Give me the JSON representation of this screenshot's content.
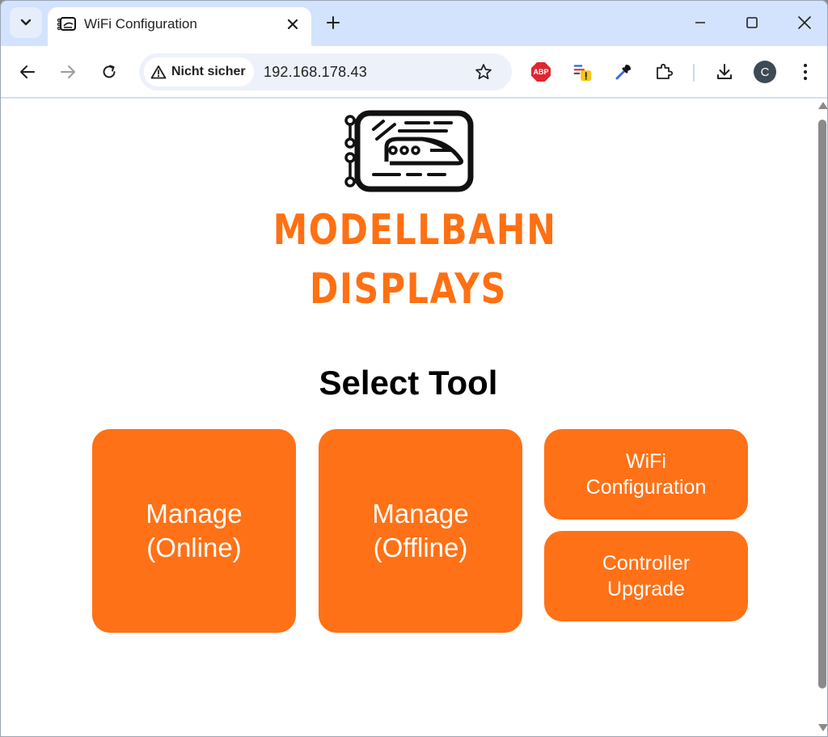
{
  "browser": {
    "tab_title": "WiFi Configuration",
    "security_label": "Nicht sicher",
    "url": "192.168.178.43",
    "profile_initial": "C",
    "abp_label": "ABP"
  },
  "icons": {
    "tab_search": "chevron-down-icon",
    "favicon": "display-train-icon",
    "tab_close": "close-icon",
    "new_tab": "plus-icon",
    "minimize": "minimize-icon",
    "maximize": "maximize-icon",
    "close_window": "close-icon",
    "back": "arrow-left-icon",
    "forward": "arrow-right-icon",
    "reload": "reload-icon",
    "security": "warning-triangle-icon",
    "bookmark": "star-icon",
    "adblock": "abp-icon",
    "tab_list_ext": "list-warning-icon",
    "eyedropper": "eyedropper-icon",
    "extensions": "puzzle-icon",
    "downloads": "download-icon",
    "menu": "kebab-menu-icon"
  },
  "page": {
    "brand_line1": "MODELLBAHN",
    "brand_line2": "DISPLAYS",
    "title": "Select Tool",
    "buttons": [
      {
        "line1": "Manage",
        "line2": "(Online)"
      },
      {
        "line1": "Manage",
        "line2": "(Offline)"
      },
      {
        "line1": "WiFi",
        "line2": "Configuration"
      },
      {
        "line1": "Controller",
        "line2": "Upgrade"
      }
    ]
  },
  "colors": {
    "accent": "#ff7116",
    "tab_strip": "#d3e3fd",
    "omnibox": "#edf1fa"
  }
}
